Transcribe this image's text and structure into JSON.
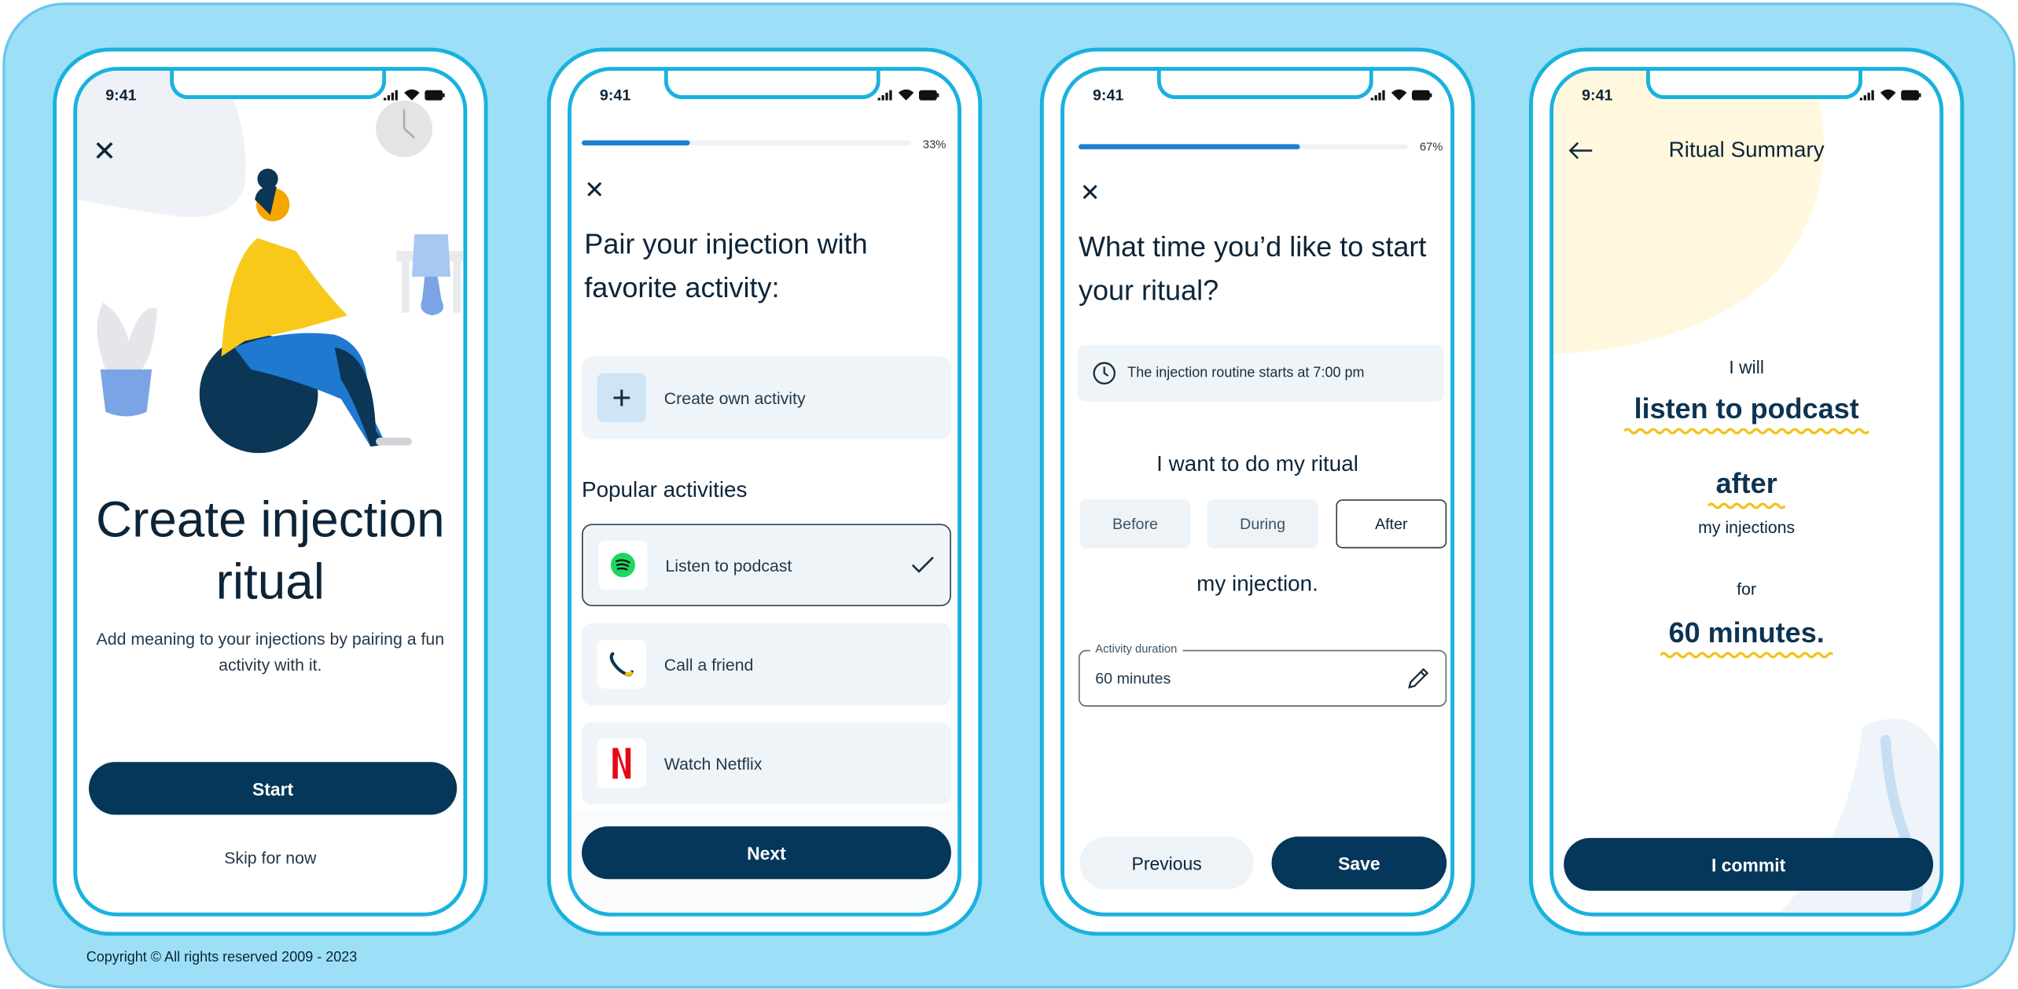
{
  "status_time": "9:41",
  "footer": {
    "copyright": "Copyright © All rights reserved 2009 - 2023"
  },
  "colors": {
    "primary": "#04375a",
    "frame": "#19b2de",
    "background": "#9cdff6",
    "progress": "#1d7fd1",
    "squiggle": "#f2c21b"
  },
  "screen1": {
    "title": "Create injection ritual",
    "subtitle": "Add meaning to your injections by pairing a fun activity with it.",
    "start_label": "Start",
    "skip_label": "Skip for now"
  },
  "screen2": {
    "progress_percent": 33,
    "progress_label": "33%",
    "heading": "Pair your injection with favorite activity:",
    "create_label": "Create own activity",
    "section_title": "Popular activities",
    "activities": [
      {
        "label": "Listen to podcast",
        "icon": "spotify-icon",
        "selected": true
      },
      {
        "label": "Call a friend",
        "icon": "phone-icon",
        "selected": false
      },
      {
        "label": "Watch Netflix",
        "icon": "netflix-icon",
        "selected": false
      }
    ],
    "next_label": "Next"
  },
  "screen3": {
    "progress_percent": 67,
    "progress_label": "67%",
    "heading": "What time you’d like to start your ritual?",
    "info": "The injection routine starts at 7:00 pm",
    "prompt": "I want to do my ritual",
    "options": [
      {
        "label": "Before",
        "selected": false
      },
      {
        "label": "During",
        "selected": false
      },
      {
        "label": "After",
        "selected": true
      }
    ],
    "suffix": "my injection.",
    "duration_label": "Activity duration",
    "duration_value": "60 minutes",
    "previous_label": "Previous",
    "save_label": "Save"
  },
  "screen4": {
    "title": "Ritual Summary",
    "line1": "I will",
    "activity": "listen to podcast",
    "timing": "after",
    "line2": "my injections",
    "line3": "for",
    "duration": "60 minutes.",
    "commit_label": "I commit"
  }
}
